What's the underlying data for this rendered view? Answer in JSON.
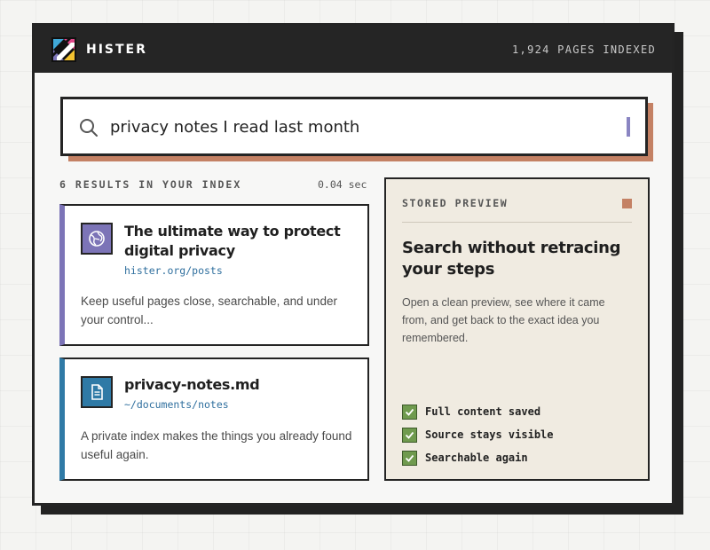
{
  "app": {
    "name": "HISTER",
    "pages_indexed": "1,924 PAGES INDEXED"
  },
  "search": {
    "query": "privacy notes I read last month",
    "icon": "search-icon"
  },
  "results": {
    "count_label": "6 RESULTS IN YOUR INDEX",
    "time": "0.04 sec",
    "items": [
      {
        "title": "The ultimate way to protect digital privacy",
        "url": "hister.org/posts",
        "description": "Keep useful pages close, searchable, and under your control...",
        "icon": "globe-icon",
        "accent": "#7c74b7"
      },
      {
        "title": "privacy-notes.md",
        "url": "~/documents/notes",
        "description": "A private index makes the things you already found useful again.",
        "icon": "document-icon",
        "accent": "#2f7aa6"
      }
    ]
  },
  "preview": {
    "label": "STORED PREVIEW",
    "title": "Search without retracing your steps",
    "description": "Open a clean preview, see where it came from, and get back to the exact idea you remembered.",
    "features": [
      "Full content saved",
      "Source stays visible",
      "Searchable again"
    ]
  },
  "colors": {
    "accent_orange": "#c48164",
    "accent_purple": "#7c74b7",
    "accent_blue": "#2f7aa6",
    "check_green": "#6f9a4e"
  }
}
